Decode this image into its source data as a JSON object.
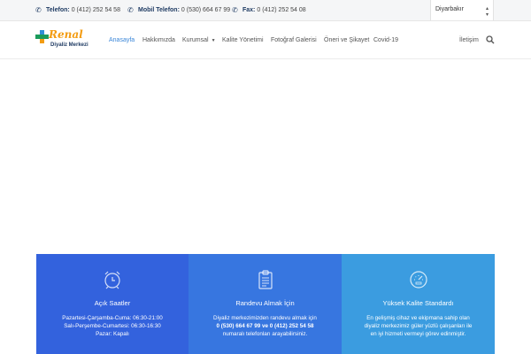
{
  "topbar": {
    "phone": {
      "label": "Telefon:",
      "value": "0 (412) 252 54 58"
    },
    "mobile": {
      "label": "Mobil Telefon:",
      "value": "0 (530) 664 67 99"
    },
    "fax": {
      "label": "Fax:",
      "value": "0 (412) 252 54 08"
    },
    "city_select": "Diyarbakır"
  },
  "logo": {
    "name": "Renal",
    "subtitle": "Diyaliz Merkezi"
  },
  "nav": {
    "items": [
      {
        "label": "Anasayfa",
        "active": true
      },
      {
        "label": "Hakkımızda"
      },
      {
        "label": "Kurumsal"
      },
      {
        "label": "Kalite Yönetimi"
      },
      {
        "label": "Fotoğraf Galerisi"
      },
      {
        "label": "Öneri ve Şikayet"
      },
      {
        "label": "Covid-19"
      },
      {
        "label": "İletişim"
      }
    ]
  },
  "features": [
    {
      "icon": "alarm-clock-icon",
      "title": "Açık Saatler",
      "lines": [
        "Pazartesi-Çarşamba-Cuma: 06:30-21:00",
        "Salı-Perşembe-Cumartesi: 06:30-16:30",
        "Pazar: Kapalı"
      ]
    },
    {
      "icon": "clipboard-icon",
      "title": "Randevu Almak İçin",
      "lines": [
        "Diyaliz merkezimizden randevu almak için",
        "0 (530) 664 67 99 ve 0 (412) 252 54 58",
        "numaralı telefonları arayabilirsiniz."
      ]
    },
    {
      "icon": "speedometer-icon",
      "title": "Yüksek Kalite Standardı",
      "lines": [
        "En gelişmiş cihaz ve ekipmana sahip olan",
        "diyaliz merkezimiz güler yüzlü çalışanları ile",
        "en iyi hizmeti vermeyi görev edinmiştir."
      ]
    }
  ],
  "colors": {
    "accent": "#3a86d8",
    "box1": "#3362dd",
    "box2": "#3776e0",
    "box3": "#3b9ce0"
  }
}
